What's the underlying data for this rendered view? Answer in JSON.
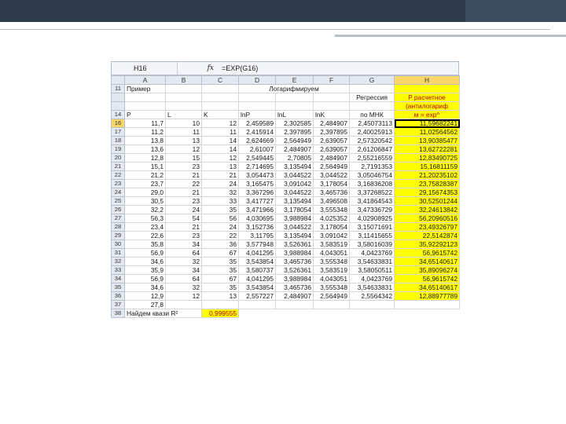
{
  "formula_bar": {
    "name_box": "H16",
    "fx": "fx",
    "formula": "=EXP(G16)"
  },
  "columns": [
    "",
    "A",
    "B",
    "C",
    "D",
    "E",
    "F",
    "G",
    "H"
  ],
  "header_row11": {
    "num": "11",
    "a": "Пример",
    "d": "Логарифмируем"
  },
  "header_row12": {
    "g": "Регрессия",
    "h": "P расчетное"
  },
  "header_row13": {
    "h": "(антилогариф"
  },
  "header_row14": {
    "num": "14",
    "a": "P",
    "b": "L",
    "c": "K",
    "d": "lnP",
    "e": "lnL",
    "f": "lnK",
    "g": "по МНК",
    "h": "м = exp^"
  },
  "rows": [
    {
      "n": "16",
      "a": "11,7",
      "b": "10",
      "c": "12",
      "d": "2,459589",
      "e": "2,302585",
      "f": "2,484907",
      "g": "2,45073113",
      "h": "11,59682241"
    },
    {
      "n": "17",
      "a": "11,2",
      "b": "11",
      "c": "11",
      "d": "2,415914",
      "e": "2,397895",
      "f": "2,397895",
      "g": "2,40025913",
      "h": "11,02564562"
    },
    {
      "n": "18",
      "a": "13,8",
      "b": "13",
      "c": "14",
      "d": "2,624669",
      "e": "2,564949",
      "f": "2,639057",
      "g": "2,57320542",
      "h": "13,90385477"
    },
    {
      "n": "19",
      "a": "13,6",
      "b": "12",
      "c": "14",
      "d": "2,61007",
      "e": "2,484907",
      "f": "2,639057",
      "g": "2,61206847",
      "h": "13,62722281"
    },
    {
      "n": "20",
      "a": "12,8",
      "b": "15",
      "c": "12",
      "d": "2,549445",
      "e": "2,70805",
      "f": "2,484907",
      "g": "2,55216559",
      "h": "12,83490725"
    },
    {
      "n": "21",
      "a": "15,1",
      "b": "23",
      "c": "13",
      "d": "2,714695",
      "e": "3,135494",
      "f": "2,564949",
      "g": "2,7191353",
      "h": "15,16811159"
    },
    {
      "n": "22",
      "a": "21,2",
      "b": "21",
      "c": "21",
      "d": "3,054473",
      "e": "3,044522",
      "f": "3,044522",
      "g": "3,05046754",
      "h": "21,20235102"
    },
    {
      "n": "23",
      "a": "23,7",
      "b": "22",
      "c": "24",
      "d": "3,165475",
      "e": "3,091042",
      "f": "3,178054",
      "g": "3,16836208",
      "h": "23,75828387"
    },
    {
      "n": "24",
      "a": "29,0",
      "b": "21",
      "c": "32",
      "d": "3,367296",
      "e": "3,044522",
      "f": "3,465736",
      "g": "3,37268522",
      "h": "29,15674353"
    },
    {
      "n": "25",
      "a": "30,5",
      "b": "23",
      "c": "33",
      "d": "3,417727",
      "e": "3,135494",
      "f": "3,496508",
      "g": "3,41864543",
      "h": "30,52501244"
    },
    {
      "n": "26",
      "a": "32,2",
      "b": "24",
      "c": "35",
      "d": "3,471966",
      "e": "3,178054",
      "f": "3,555348",
      "g": "3,47336729",
      "h": "32,24613842"
    },
    {
      "n": "27",
      "a": "56,3",
      "b": "54",
      "c": "56",
      "d": "4,030695",
      "e": "3,988984",
      "f": "4,025352",
      "g": "4,02908925",
      "h": "56,20960516"
    },
    {
      "n": "28",
      "a": "23,4",
      "b": "21",
      "c": "24",
      "d": "3,152736",
      "e": "3,044522",
      "f": "3,178054",
      "g": "3,15071691",
      "h": "23,49326797"
    },
    {
      "n": "29",
      "a": "22,6",
      "b": "23",
      "c": "22",
      "d": "3,11795",
      "e": "3,135494",
      "f": "3,091042",
      "g": "3,11415655",
      "h": "22,5142874"
    },
    {
      "n": "30",
      "a": "35,8",
      "b": "34",
      "c": "36",
      "d": "3,577948",
      "e": "3,526361",
      "f": "3,583519",
      "g": "3,58016039",
      "h": "35,92292123"
    },
    {
      "n": "31",
      "a": "56,9",
      "b": "64",
      "c": "67",
      "d": "4,041295",
      "e": "3,988984",
      "f": "4,043051",
      "g": "4,0423769",
      "h": "56,9615742"
    },
    {
      "n": "32",
      "a": "34,6",
      "b": "32",
      "c": "35",
      "d": "3,543854",
      "e": "3,465736",
      "f": "3,555348",
      "g": "3,54633831",
      "h": "34,65140617"
    },
    {
      "n": "33",
      "a": "35,9",
      "b": "34",
      "c": "35",
      "d": "3,580737",
      "e": "3,526361",
      "f": "3,583519",
      "g": "3,58050511",
      "h": "35,89096274"
    },
    {
      "n": "34",
      "a": "56,9",
      "b": "64",
      "c": "67",
      "d": "4,041295",
      "e": "3,988984",
      "f": "4,043051",
      "g": "4,0423769",
      "h": "56,9615742"
    },
    {
      "n": "35",
      "a": "34,6",
      "b": "32",
      "c": "35",
      "d": "3,543854",
      "e": "3,465736",
      "f": "3,555348",
      "g": "3,54633831",
      "h": "34,65140617"
    },
    {
      "n": "36",
      "a": "12,9",
      "b": "12",
      "c": "13",
      "d": "2,557227",
      "e": "2,484907",
      "f": "2,564949",
      "g": "2,5564342",
      "h": "12,88977789"
    },
    {
      "n": "37",
      "a": "27,8",
      "b": "",
      "c": "",
      "d": "",
      "e": "",
      "f": "",
      "g": "",
      "h": ""
    }
  ],
  "footer_row": {
    "num": "38",
    "label": "Найдем квази R²",
    "value": "0,999555"
  },
  "colors": {
    "selected_column": "#f9d66a",
    "highlight": "#ffff00",
    "red_text": "#c00000",
    "topbar": "#2e3b4a"
  }
}
